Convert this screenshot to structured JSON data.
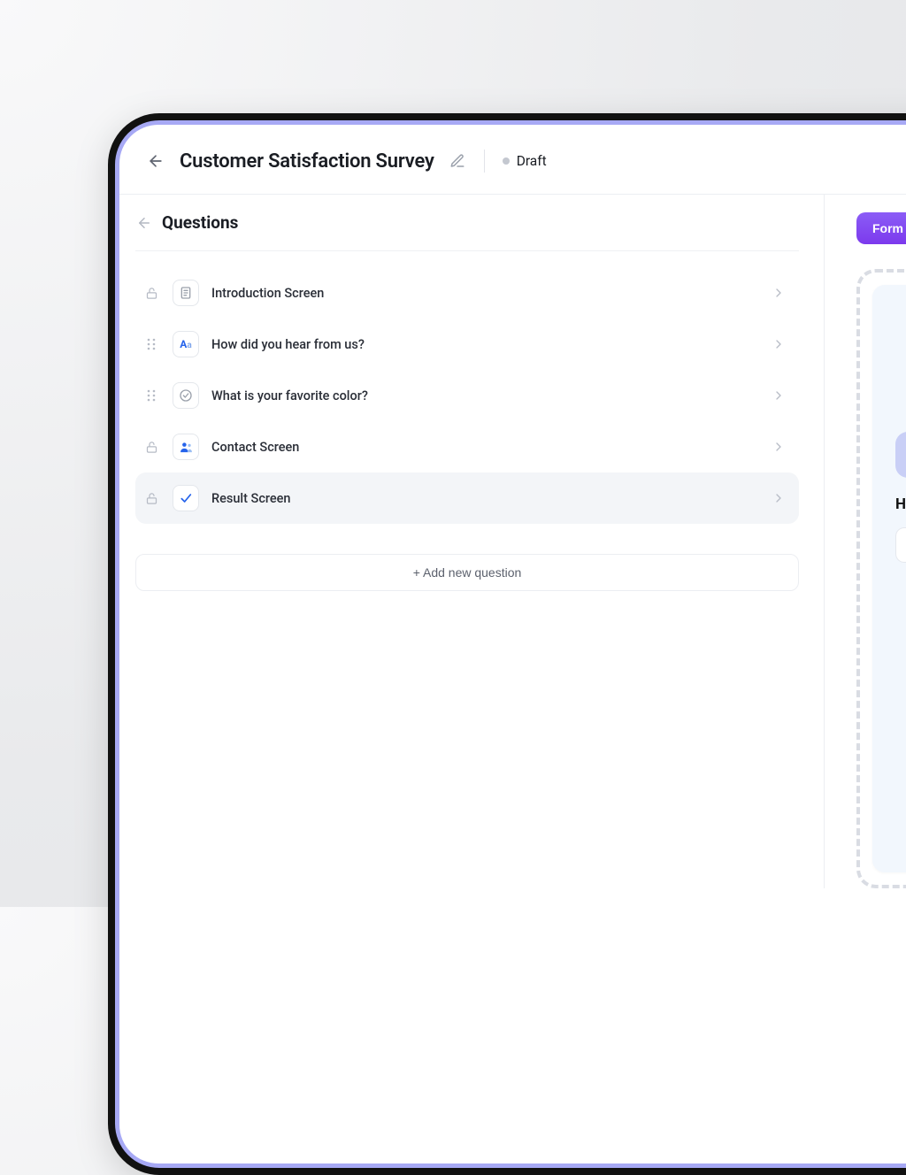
{
  "header": {
    "title": "Customer Satisfaction Survey",
    "status_label": "Draft"
  },
  "panel": {
    "title": "Questions",
    "add_button": "+ Add new question"
  },
  "questions": [
    {
      "label": "Introduction Screen",
      "icon": "document-icon",
      "handle": "lock",
      "selected": false
    },
    {
      "label": "How did you hear from us?",
      "icon": "text-icon",
      "handle": "drag",
      "selected": false
    },
    {
      "label": "What is your favorite color?",
      "icon": "check-circle-icon",
      "handle": "drag",
      "selected": false
    },
    {
      "label": "Contact Screen",
      "icon": "contact-icon",
      "handle": "lock",
      "selected": false
    },
    {
      "label": "Result Screen",
      "icon": "check-icon",
      "handle": "lock",
      "selected": true
    }
  ],
  "preview": {
    "button_label": "Form",
    "question_prefix": "H"
  },
  "colors": {
    "accent": "#7c3aed",
    "icon_blue": "#2563eb"
  }
}
